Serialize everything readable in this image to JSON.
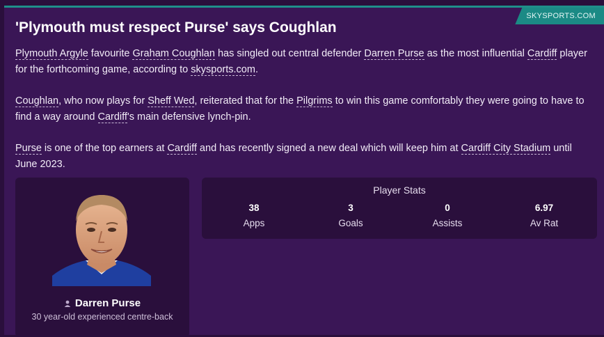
{
  "source": "SKYSPORTS.COM",
  "headline": "'Plymouth must respect Purse' says Coughlan",
  "paragraphs": [
    [
      {
        "t": "Plymouth Argyle",
        "link": true
      },
      {
        "t": " favourite ",
        "link": false
      },
      {
        "t": "Graham Coughlan",
        "link": true
      },
      {
        "t": " has singled out central defender ",
        "link": false
      },
      {
        "t": "Darren Purse",
        "link": true
      },
      {
        "t": " as the most influential ",
        "link": false
      },
      {
        "t": "Cardiff",
        "link": true
      },
      {
        "t": " player for the forthcoming game, according to ",
        "link": false
      },
      {
        "t": "skysports.com",
        "link": true
      },
      {
        "t": ".",
        "link": false
      }
    ],
    [
      {
        "t": "Coughlan",
        "link": true
      },
      {
        "t": ", who now plays for ",
        "link": false
      },
      {
        "t": "Sheff Wed",
        "link": true
      },
      {
        "t": ", reiterated that for the ",
        "link": false
      },
      {
        "t": "Pilgrims",
        "link": true
      },
      {
        "t": " to win this game comfortably they were going to have to find a way around ",
        "link": false
      },
      {
        "t": "Cardiff",
        "link": true
      },
      {
        "t": "'s main defensive lynch-pin.",
        "link": false
      }
    ],
    [
      {
        "t": "Purse",
        "link": true
      },
      {
        "t": " is one of the top earners at ",
        "link": false
      },
      {
        "t": "Cardiff",
        "link": true
      },
      {
        "t": " and has recently signed a new deal which will keep him at ",
        "link": false
      },
      {
        "t": "Cardiff City Stadium",
        "link": true
      },
      {
        "t": " until June 2023.",
        "link": false
      }
    ]
  ],
  "player": {
    "name": "Darren Purse",
    "description": "30 year-old experienced centre-back"
  },
  "stats": {
    "title": "Player Stats",
    "items": [
      {
        "value": "38",
        "label": "Apps"
      },
      {
        "value": "3",
        "label": "Goals"
      },
      {
        "value": "0",
        "label": "Assists"
      },
      {
        "value": "6.97",
        "label": "Av Rat"
      }
    ]
  },
  "colors": {
    "background": "#2a0f3c",
    "panel": "#3a1656",
    "accent": "#1b8a85"
  }
}
